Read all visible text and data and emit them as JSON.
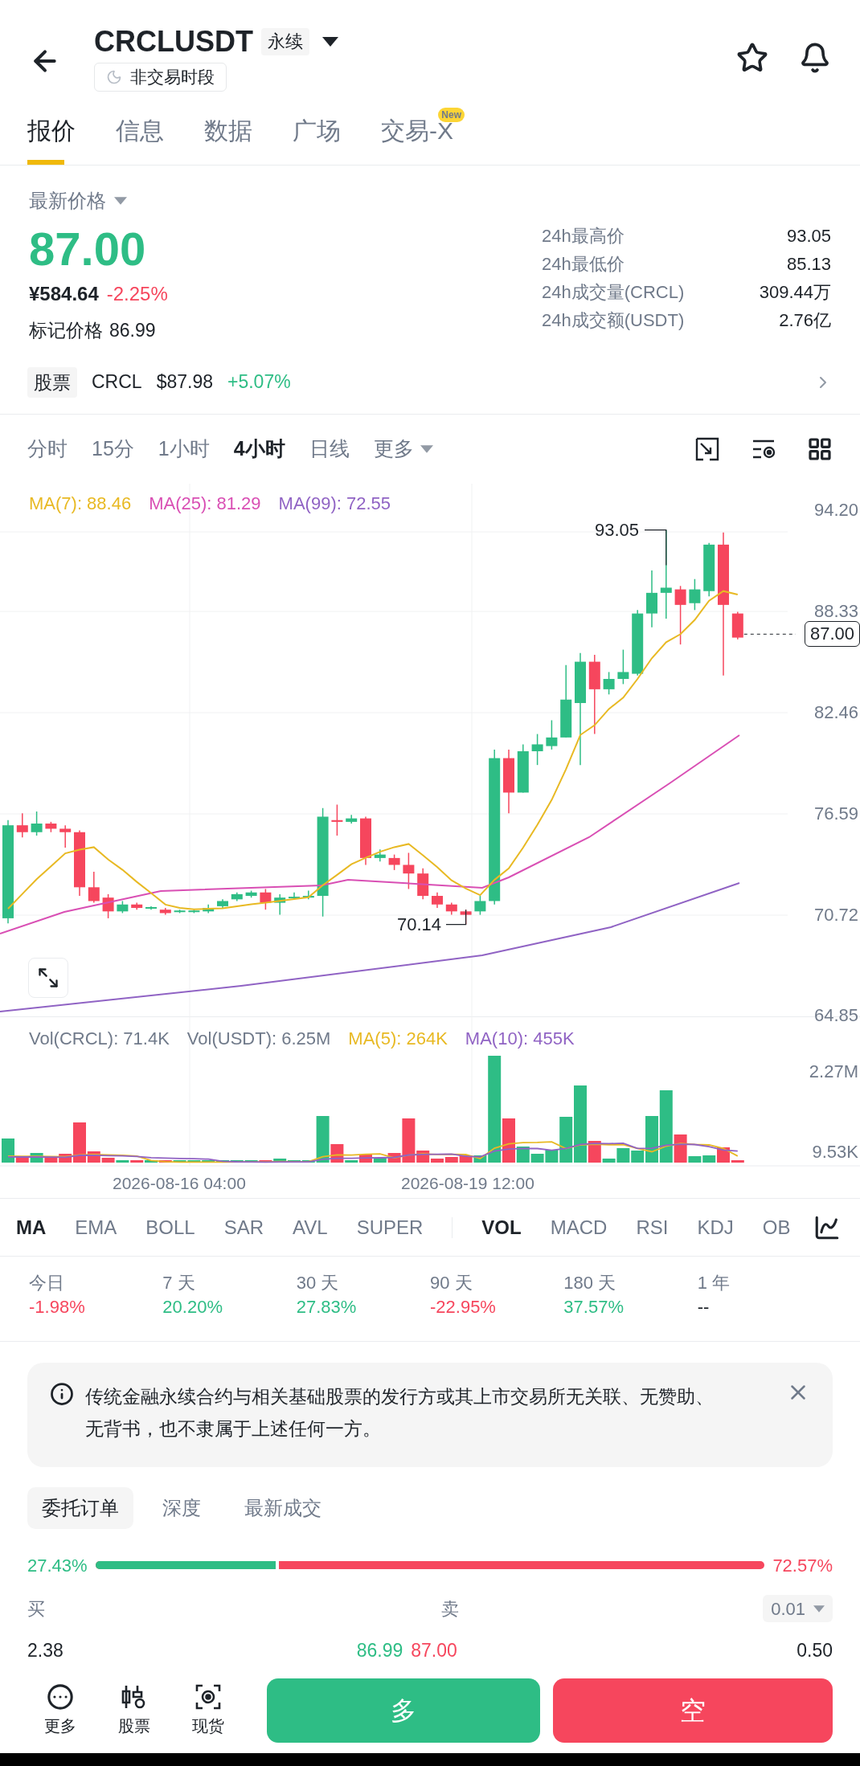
{
  "header": {
    "title": "CRCLUSDT",
    "badge": "永续",
    "status": "非交易时段"
  },
  "tabs": [
    {
      "label": "报价",
      "selected": true
    },
    {
      "label": "信息",
      "selected": false
    },
    {
      "label": "数据",
      "selected": false
    },
    {
      "label": "广场",
      "selected": false
    },
    {
      "label": "交易-X",
      "selected": false,
      "badge": "New"
    }
  ],
  "price": {
    "label": "最新价格",
    "last": "87.00",
    "cny": "¥584.64",
    "change": "-2.25%",
    "mark_label": "标记价格",
    "mark": "86.99"
  },
  "stats": [
    {
      "label": "24h最高价",
      "value": "93.05"
    },
    {
      "label": "24h最低价",
      "value": "85.13"
    },
    {
      "label": "24h成交量(CRCL)",
      "value": "309.44万"
    },
    {
      "label": "24h成交额(USDT)",
      "value": "2.76亿"
    }
  ],
  "stock": {
    "tag": "股票",
    "symbol": "CRCL",
    "price": "$87.98",
    "change": "+5.07%"
  },
  "timeframes": [
    {
      "label": "分时",
      "selected": false
    },
    {
      "label": "15分",
      "selected": false
    },
    {
      "label": "1小时",
      "selected": false
    },
    {
      "label": "4小时",
      "selected": true
    },
    {
      "label": "日线",
      "selected": false
    }
  ],
  "more": "更多",
  "chart": {
    "legend": [
      {
        "label": "MA(7): 88.46",
        "color": "#e8b923"
      },
      {
        "label": "MA(25): 81.29",
        "color": "#d94fb4"
      },
      {
        "label": "MA(99): 72.55",
        "color": "#9063c4"
      }
    ],
    "y_ticks": [
      "94.20",
      "88.33",
      "82.46",
      "76.59",
      "70.72",
      "64.85"
    ],
    "high_label": "93.05",
    "low_label": "70.14",
    "last_tag": "87.00"
  },
  "volume": {
    "legend": [
      {
        "label": "Vol(CRCL): 71.4K",
        "color": "#707a8a"
      },
      {
        "label": "Vol(USDT): 6.25M",
        "color": "#707a8a"
      },
      {
        "label": "MA(5): 264K",
        "color": "#e8b923"
      },
      {
        "label": "MA(10): 455K",
        "color": "#9063c4"
      }
    ],
    "y_ticks": [
      "2.27M",
      "9.53K"
    ],
    "x_labels": [
      "2026-08-16 04:00",
      "2026-08-19 12:00"
    ]
  },
  "main_indicators": [
    {
      "label": "MA",
      "selected": true
    },
    {
      "label": "EMA",
      "selected": false
    },
    {
      "label": "BOLL",
      "selected": false
    },
    {
      "label": "SAR",
      "selected": false
    },
    {
      "label": "AVL",
      "selected": false
    },
    {
      "label": "SUPER",
      "selected": false
    }
  ],
  "sub_indicators": [
    {
      "label": "VOL",
      "selected": true
    },
    {
      "label": "MACD",
      "selected": false
    },
    {
      "label": "RSI",
      "selected": false
    },
    {
      "label": "KDJ",
      "selected": false
    },
    {
      "label": "OB",
      "selected": false
    }
  ],
  "periods": [
    {
      "label": "今日",
      "value": "-1.98%",
      "color": "#f6465d"
    },
    {
      "label": "7 天",
      "value": "20.20%",
      "color": "#2ebd85"
    },
    {
      "label": "30 天",
      "value": "27.83%",
      "color": "#2ebd85"
    },
    {
      "label": "90 天",
      "value": "-22.95%",
      "color": "#f6465d"
    },
    {
      "label": "180 天",
      "value": "37.57%",
      "color": "#2ebd85"
    },
    {
      "label": "1 年",
      "value": "--",
      "color": "#1e2329"
    }
  ],
  "notice": "传统金融永续合约与相关基础股票的发行方或其上市交易所无关联、无赞助、无背书，也不隶属于上述任何一方。",
  "order_tabs": [
    {
      "label": "委托订单",
      "selected": true
    },
    {
      "label": "深度",
      "selected": false
    },
    {
      "label": "最新成交",
      "selected": false
    }
  ],
  "ratio": {
    "buy": "27.43%",
    "sell": "72.57%",
    "level": 0.2743
  },
  "book": {
    "buy_label": "买",
    "sell_label": "卖",
    "precision": "0.01",
    "bid_qty": "2.38",
    "bid": "86.99",
    "ask": "87.00",
    "ask_qty": "0.50"
  },
  "bottom": {
    "actions": [
      {
        "label": "更多",
        "kind": "more"
      },
      {
        "label": "股票",
        "kind": "stock"
      },
      {
        "label": "现货",
        "kind": "spot"
      }
    ],
    "long": "多",
    "short": "空"
  }
}
